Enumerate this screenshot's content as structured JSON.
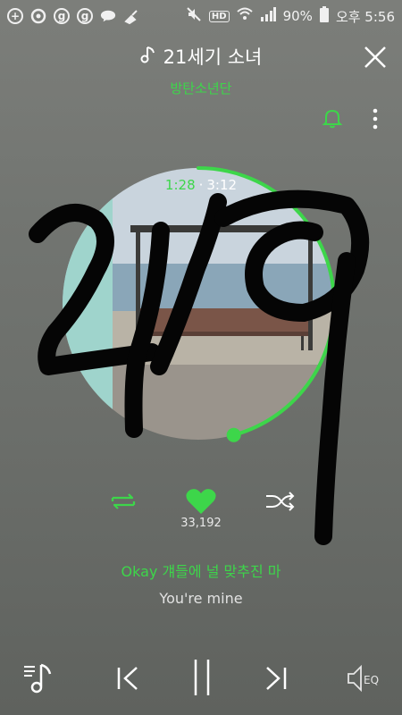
{
  "status": {
    "battery": "90%",
    "time": "오후 5:56",
    "hd": "HD"
  },
  "header": {
    "title": "21세기 소녀",
    "artist": "방탄소년단"
  },
  "player": {
    "current_time": "1:28",
    "separator": "·",
    "total_time": "3:12",
    "progress_fraction": 0.458,
    "like_count": "33,192"
  },
  "lyrics": {
    "current": "Okay 걔들에 널 맞추진 마",
    "next": "You're mine"
  },
  "colors": {
    "accent": "#3dd64a",
    "background": "#727571"
  },
  "icons": {
    "music_note": "music-note-icon",
    "close": "close-icon",
    "bell": "bell-icon",
    "more": "more-vertical-icon",
    "repeat": "repeat-icon",
    "heart": "heart-icon",
    "shuffle": "shuffle-icon",
    "playlist": "playlist-icon",
    "prev": "skip-previous-icon",
    "pause": "pause-icon",
    "next": "skip-next-icon",
    "eq": "equalizer-icon"
  },
  "bottom": {
    "eq_label": "EQ"
  }
}
